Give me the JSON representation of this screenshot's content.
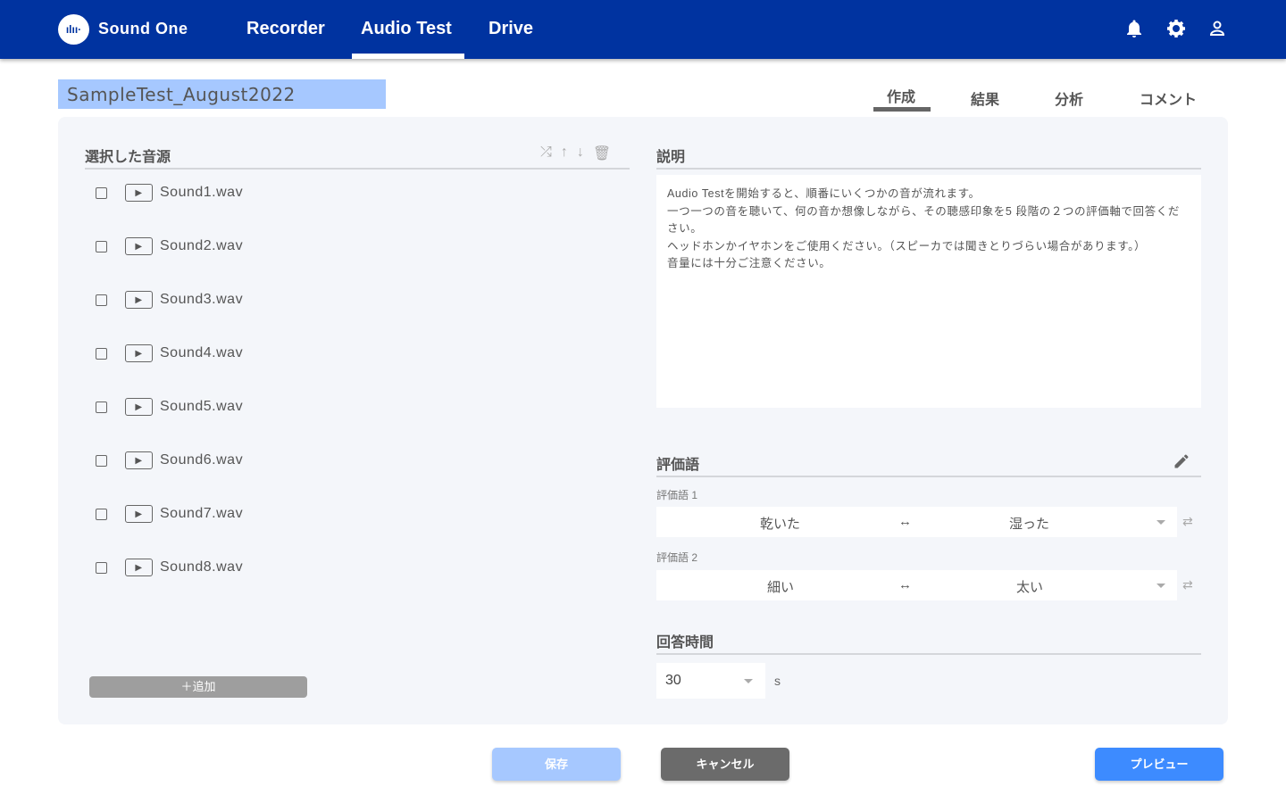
{
  "header": {
    "logo_glyph": "ılıı·",
    "brand": "Sound One",
    "nav": [
      "Recorder",
      "Audio Test",
      "Drive"
    ],
    "active_nav": "Audio Test",
    "icons": [
      "bell-icon",
      "gear-icon",
      "user-icon"
    ]
  },
  "test_name": "SampleTest_August2022",
  "tabs": [
    "作成",
    "結果",
    "分析",
    "コメント"
  ],
  "active_tab": "作成",
  "sources": {
    "title": "選択した音源",
    "tools": [
      "shuffle-icon",
      "arrow-up-icon",
      "arrow-down-icon",
      "trash-icon"
    ],
    "items": [
      "Sound1.wav",
      "Sound2.wav",
      "Sound3.wav",
      "Sound4.wav",
      "Sound5.wav",
      "Sound6.wav",
      "Sound7.wav",
      "Sound8.wav"
    ],
    "add_label": "＋追加"
  },
  "description": {
    "title": "説明",
    "text": "Audio Testを開始すると、順番にいくつかの音が流れます。\n一つ一つの音を聴いて、何の音か想像しながら、その聴感印象を5 段階の２つの評価軸で回答ください。\nヘッドホンかイヤホンをご使用ください。（スピーカでは聞きとりづらい場合があります。）\n音量には十分ご注意ください。"
  },
  "evaluation": {
    "title": "評価語",
    "terms": [
      {
        "label": "評価語 1",
        "left": "乾いた",
        "arrow": "↔",
        "right": "湿った"
      },
      {
        "label": "評価語 2",
        "left": "細い",
        "arrow": "↔",
        "right": "太い"
      }
    ]
  },
  "response_time": {
    "title": "回答時間",
    "value": "30",
    "unit": "s"
  },
  "buttons": {
    "save": "保存",
    "cancel": "キャンセル",
    "preview": "プレビュー"
  }
}
